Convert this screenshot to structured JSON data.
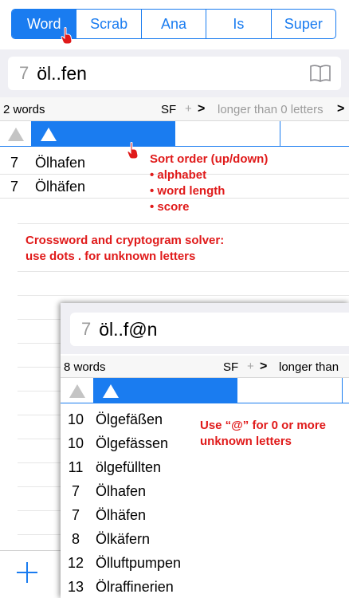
{
  "segments": [
    "Word",
    "Scrab",
    "Ana",
    "Is",
    "Super"
  ],
  "main": {
    "search": {
      "length": "7",
      "query": "öl..fen"
    },
    "info": {
      "count": "2 words",
      "sf": "SF",
      "plus": "+",
      "chevron": ">",
      "filter": "longer than 0 letters",
      "filter_chevron": ">"
    },
    "rows": [
      {
        "num": "7",
        "word": "Ölhafen"
      },
      {
        "num": "7",
        "word": "Ölhäfen"
      }
    ]
  },
  "notes": {
    "sort_title": "Sort order (up/down)",
    "sort_items": [
      "• alphabet",
      "• word length",
      "• score"
    ],
    "crossword_1": "Crossword and cryptogram solver:",
    "crossword_2": "use dots . for unknown letters",
    "at_1": "Use “@” for 0 or more",
    "at_2": "unknown letters"
  },
  "inset": {
    "search": {
      "length": "7",
      "query": "öl..f@n"
    },
    "info": {
      "count": "8 words",
      "sf": "SF",
      "plus": "+",
      "chevron": ">",
      "filter": "longer than"
    },
    "rows": [
      {
        "num": "10",
        "word": "Ölgefäßen"
      },
      {
        "num": "10",
        "word": "Ölgefässen"
      },
      {
        "num": "11",
        "word": "ölgefüllten"
      },
      {
        "num": "7",
        "word": "Ölhafen"
      },
      {
        "num": "7",
        "word": "Ölhäfen"
      },
      {
        "num": "8",
        "word": "Ölkäfern"
      },
      {
        "num": "12",
        "word": "Ölluftpumpen"
      },
      {
        "num": "13",
        "word": "Ölraffinerien"
      }
    ]
  },
  "colors": {
    "accent": "#1a7cf0",
    "annotation": "#e01a1a"
  }
}
